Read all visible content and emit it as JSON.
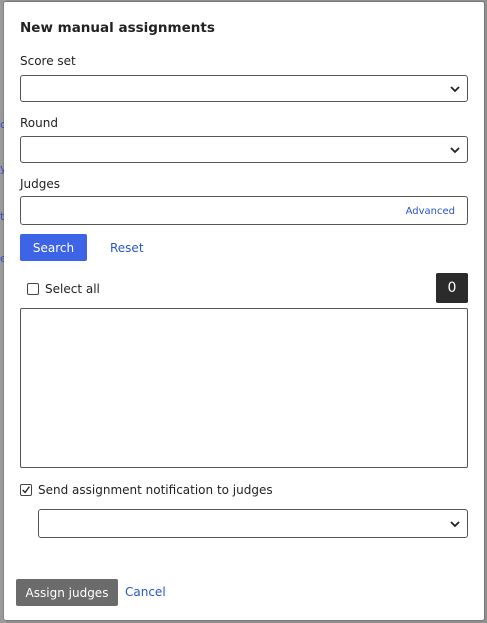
{
  "modal": {
    "title": "New manual assignments",
    "score_set": {
      "label": "Score set",
      "value": ""
    },
    "round": {
      "label": "Round",
      "value": ""
    },
    "judges": {
      "label": "Judges",
      "value": "",
      "advanced_label": "Advanced"
    },
    "search_label": "Search",
    "reset_label": "Reset",
    "select_all_label": "Select all",
    "select_all_checked": false,
    "selected_count": "0",
    "notify_label": "Send assignment notification to judges",
    "notify_checked": true,
    "notification_template": {
      "value": ""
    },
    "assign_label": "Assign judges",
    "cancel_label": "Cancel"
  },
  "colors": {
    "primary": "#3d63e6",
    "link": "#2a55c9",
    "assign_button": "#6b6b6b",
    "count_badge": "#2b2b2b",
    "backdrop": "#8f8f8f"
  },
  "icons": [
    "chevron-down-icon",
    "checkmark-icon"
  ]
}
